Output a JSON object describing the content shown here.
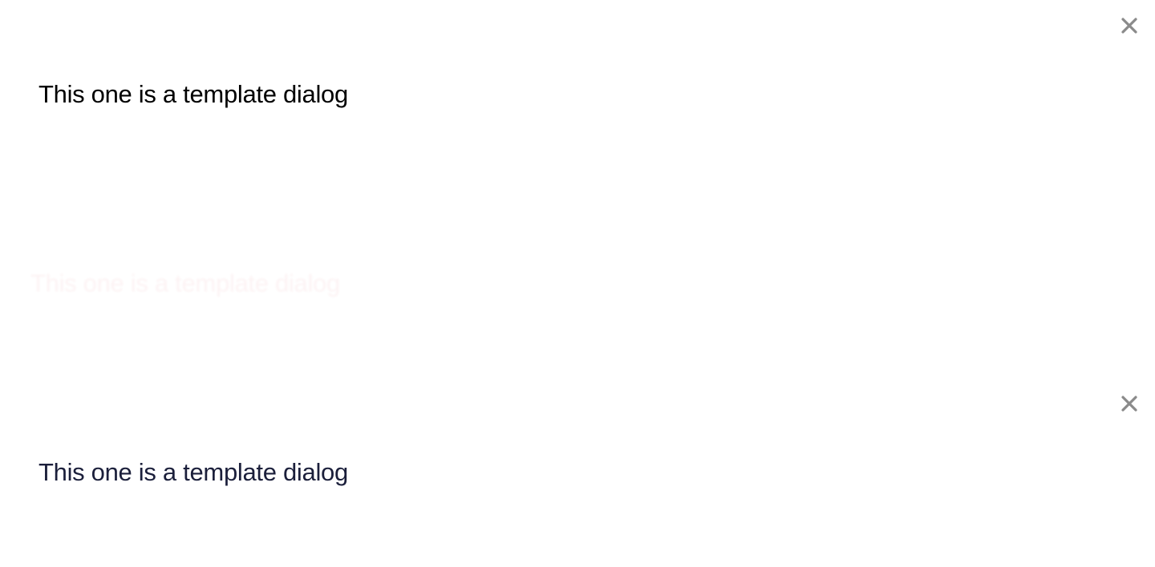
{
  "dialogs": [
    {
      "message": "This one is a template dialog",
      "close_label": "×"
    },
    {
      "message": "This one is a template dialog"
    },
    {
      "message": "This one is a template dialog",
      "close_label": "×"
    }
  ],
  "colors": {
    "close_icon": "#8a8a8a",
    "text_primary": "#000000",
    "text_navy": "#1b1f3b",
    "text_faded": "#d63a4a"
  }
}
